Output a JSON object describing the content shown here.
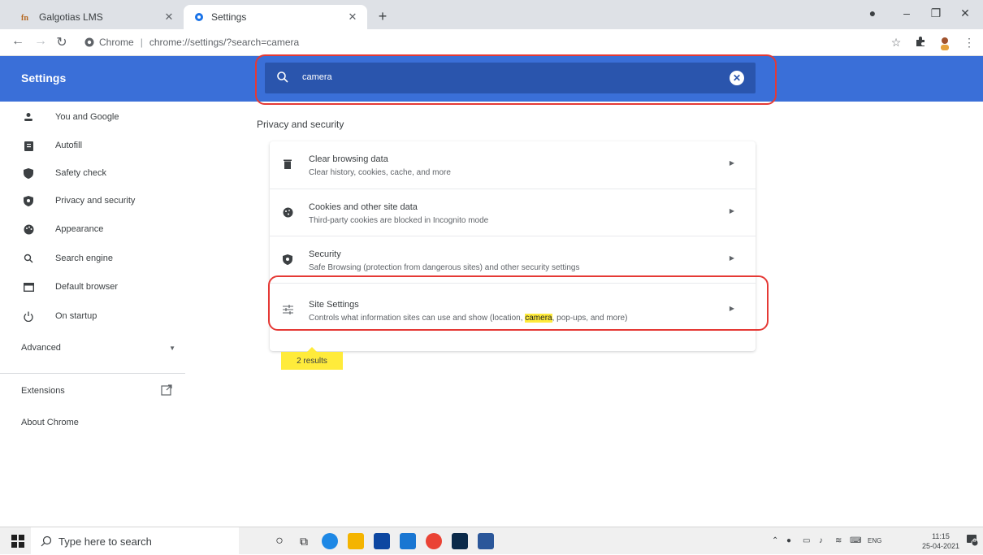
{
  "browser": {
    "tabs": [
      {
        "title": "Galgotias LMS",
        "favicon": "galgotias-favicon"
      },
      {
        "title": "Settings",
        "favicon": "gear-icon"
      }
    ],
    "address": {
      "origin": "Chrome",
      "url": "chrome://settings/?search=camera"
    }
  },
  "header": {
    "title": "Settings",
    "search": {
      "value": "camera"
    }
  },
  "sidebar": {
    "items": [
      {
        "label": "You and Google",
        "icon": "person-icon"
      },
      {
        "label": "Autofill",
        "icon": "clipboard-icon"
      },
      {
        "label": "Safety check",
        "icon": "shield-check-icon"
      },
      {
        "label": "Privacy and security",
        "icon": "shield-icon"
      },
      {
        "label": "Appearance",
        "icon": "palette-icon"
      },
      {
        "label": "Search engine",
        "icon": "search-icon"
      },
      {
        "label": "Default browser",
        "icon": "browser-icon"
      },
      {
        "label": "On startup",
        "icon": "power-icon"
      }
    ],
    "advanced": "Advanced",
    "extensions": "Extensions",
    "about": "About Chrome"
  },
  "main": {
    "section_title": "Privacy and security",
    "rows": [
      {
        "title": "Clear browsing data",
        "description": "Clear history, cookies, cache, and more",
        "icon": "trash-icon"
      },
      {
        "title": "Cookies and other site data",
        "description": "Third-party cookies are blocked in Incognito mode",
        "icon": "cookie-icon"
      },
      {
        "title": "Security",
        "description": "Safe Browsing (protection from dangerous sites) and other security settings",
        "icon": "shield-icon"
      },
      {
        "title": "Site Settings",
        "description_before": "Controls what information sites can use and show (location, ",
        "description_highlight": "camera",
        "description_after": ", pop-ups, and more)",
        "icon": "sliders-icon"
      }
    ],
    "results_label": "2 results"
  },
  "taskbar": {
    "search_placeholder": "Type here to search",
    "lang": "ENG",
    "time": "11:15",
    "date": "25-04-2021",
    "notifications": "8"
  },
  "colors": {
    "header_blue": "#3a6fd8",
    "search_blue": "#2a55ad",
    "highlight": "#ffeb3b",
    "annotation_red": "#e53935"
  }
}
